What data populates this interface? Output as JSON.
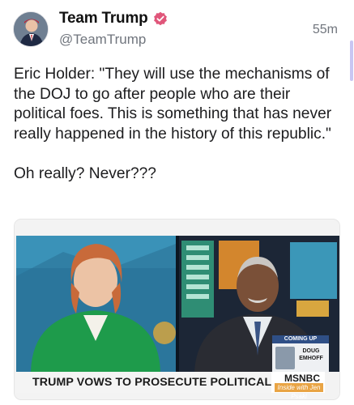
{
  "post": {
    "display_name": "Team Trump",
    "handle": "@TeamTrump",
    "timestamp": "55m",
    "body": "Eric Holder: \"They will use the mechanisms of the DOJ to go after people who are their political foes. This is something that has never really happened in the history of this republic.\"\n\nOh really? Never???"
  },
  "media": {
    "chyron": "TRUMP VOWS TO PROSECUTE POLITICAL FOES",
    "network": "MSNBC",
    "network_sub": "Inside with Jen Psaki",
    "coming_up_label": "COMING UP",
    "coming_up_name": "DOUG EMHOFF"
  },
  "icons": {
    "verified_badge": "verified-badge-icon",
    "avatar": "avatar"
  },
  "colors": {
    "verified": "#e0567a",
    "accent_scroll": "#c9c6f2",
    "chyron_bg": "#f4f4f4",
    "coming_up_header": "#2f4f86",
    "brand_sub": "#e9a444"
  }
}
